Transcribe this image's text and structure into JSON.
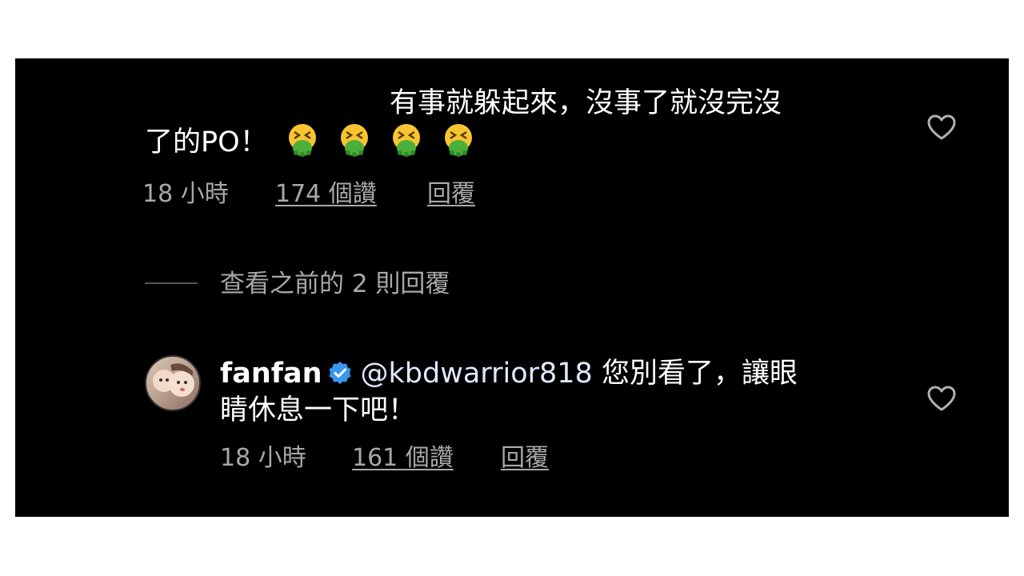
{
  "comment1": {
    "line1": "有事就躲起來，沒事了就沒完沒",
    "line2": "了的PO！",
    "emoji_count": 4,
    "time": "18 小時",
    "likes": "174 個讚",
    "reply": "回覆"
  },
  "view_previous": "查看之前的 2 則回覆",
  "comment2": {
    "username": "fanfan",
    "mention": "@kbdwarrior818",
    "text_line1": " 您別看了，讓眼",
    "text_line2": "睛休息一下吧！",
    "time": "18 小時",
    "likes": "161 個讚",
    "reply": "回覆"
  },
  "colors": {
    "background": "#000000",
    "meta_text": "#a8a8a8",
    "verified": "#3897f0",
    "emoji_face": "#f7c531",
    "emoji_vomit": "#4caf3a"
  },
  "icons": {
    "heart": "heart-outline-icon",
    "verified": "verified-badge-icon",
    "emoji": "face-vomiting-emoji"
  }
}
